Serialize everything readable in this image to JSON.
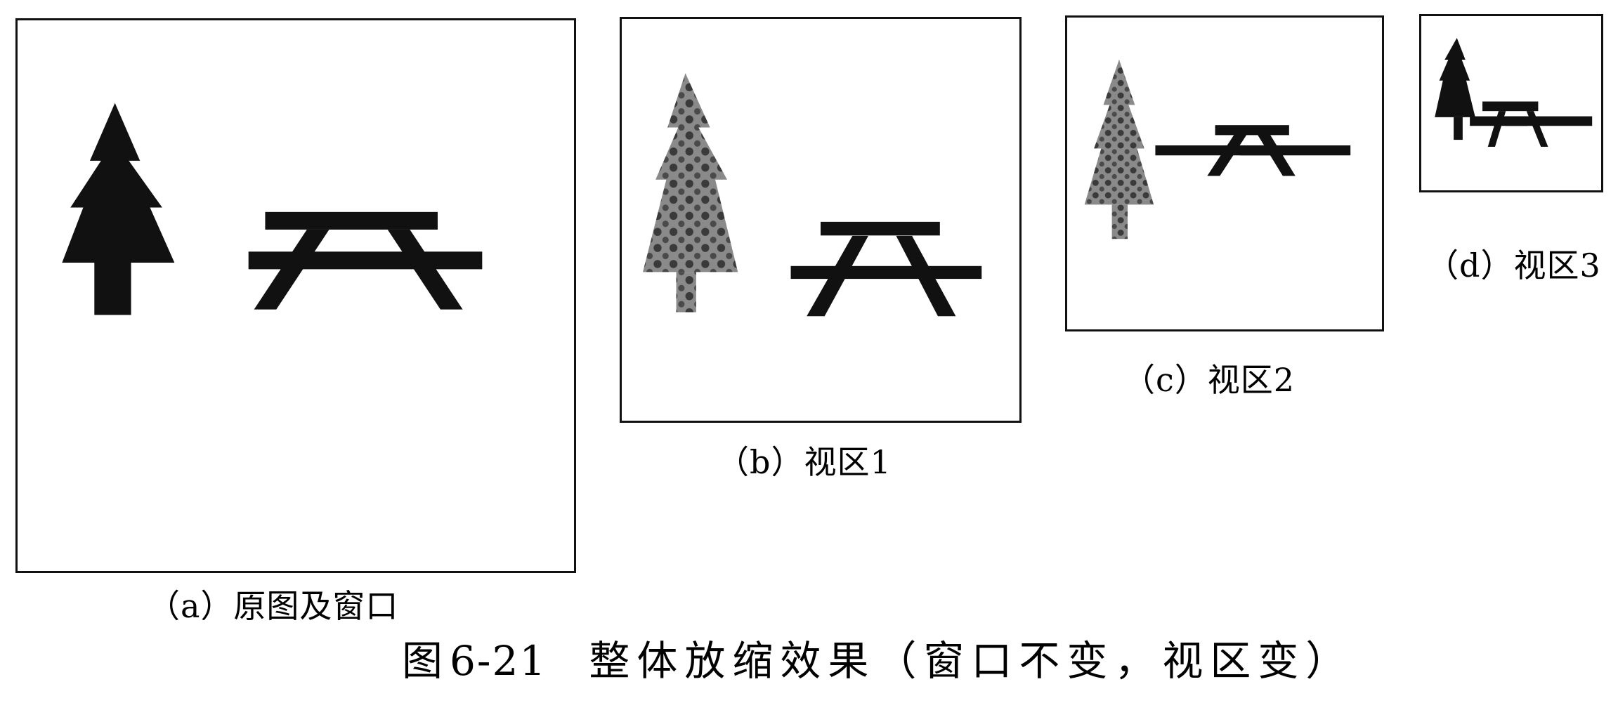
{
  "panels": [
    {
      "id": "a",
      "caption": "（a）原图及窗口",
      "tree_fill": "#111111"
    },
    {
      "id": "b",
      "caption": "（b）视区1",
      "tree_fill": "#6e6e6e"
    },
    {
      "id": "c",
      "caption": "（c）视区2",
      "tree_fill": "#7a7a7a"
    },
    {
      "id": "d",
      "caption": "（d）视区3",
      "tree_fill": "#111111"
    }
  ],
  "figure": {
    "label": "图",
    "number": "6-21",
    "title": "整体放缩效果（窗口不变，视区变）"
  },
  "colors": {
    "border": "#111111",
    "table": "#111111",
    "background": "#ffffff"
  },
  "icons": [
    "tree-icon",
    "picnic-table-icon"
  ]
}
